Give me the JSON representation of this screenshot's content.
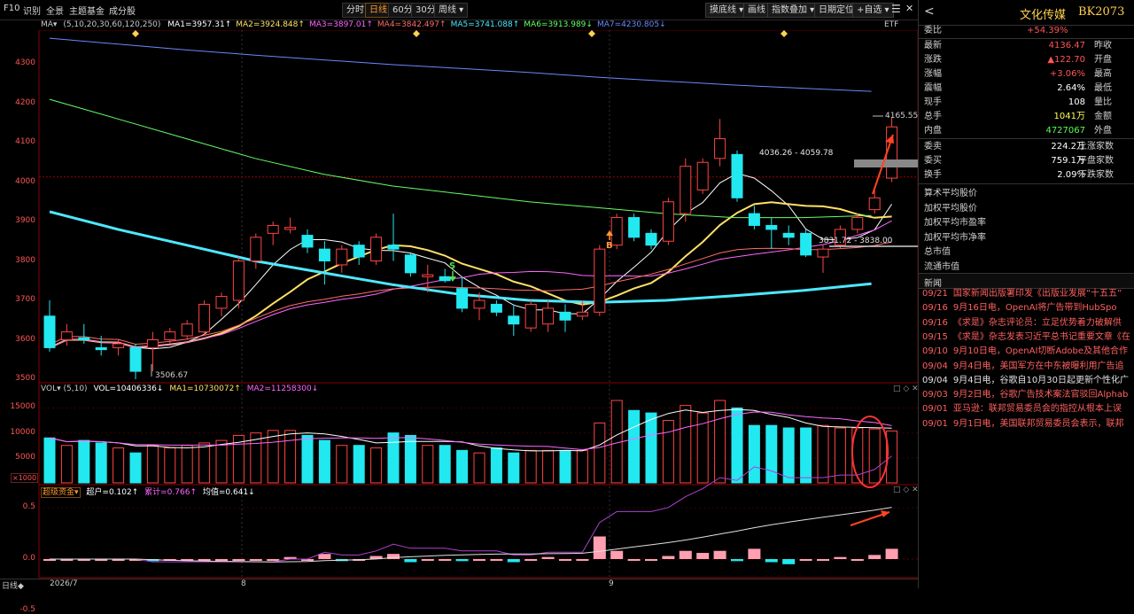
{
  "toolbar": {
    "left_links": [
      "F10",
      "识别",
      "全景",
      "主题基金",
      "成分股"
    ],
    "period_buttons": [
      "分时",
      "日线",
      "60分",
      "30分",
      "周线 ▾"
    ],
    "active_period": "日线",
    "right_buttons": [
      "摸底线 ▾",
      "画线",
      "指数叠加 ▾",
      "日期定位",
      "+自选 ▾"
    ],
    "icons": [
      "☰",
      "✕"
    ]
  },
  "ma_legend": {
    "name": "MA▾",
    "params": "(5,10,20,30,60,120,250)",
    "items": [
      {
        "text": "MA1=3957.31↑",
        "color": "#ffffff"
      },
      {
        "text": "MA2=3924.848↑",
        "color": "#ffe066"
      },
      {
        "text": "MA3=3897.01↑",
        "color": "#ff66ff"
      },
      {
        "text": "MA4=3842.497↑",
        "color": "#ff6b6b"
      },
      {
        "text": "MA5=3741.088↑",
        "color": "#4ee8ff"
      },
      {
        "text": "MA6=3913.989↓",
        "color": "#66ff66"
      },
      {
        "text": "MA7=4230.805↓",
        "color": "#6b88ff"
      }
    ],
    "badge": "ETF"
  },
  "price_axis": [
    "4300",
    "4200",
    "4100",
    "4000",
    "3900",
    "3800",
    "3700",
    "3600",
    "3500"
  ],
  "annotations": {
    "high_label": "4165.55",
    "low_label": "3506.67",
    "range1": "4036.26 - 4059.78",
    "range2": "3831.72 - 3838.00",
    "buy_signal": "B",
    "sell_signal": "S"
  },
  "volume_legend": {
    "name": "VOL▾",
    "params": "(5,10)",
    "vol": "VOL=10406336↓",
    "ma1": "MA1=10730072↑",
    "ma2": "MA2=11258300↓",
    "axis": [
      "15000",
      "10000",
      "5000"
    ],
    "unit": "×1000"
  },
  "capital_legend": {
    "name": "超级资金▾",
    "chao": "超户=0.102↑",
    "leiji": "累计=0.766↑",
    "junzhi": "均值=0.641↓",
    "axis": [
      "0.5",
      "0.0",
      "-0.5"
    ]
  },
  "date_axis": {
    "period": "日线◆",
    "labels": [
      "2026/7",
      "8",
      "9"
    ]
  },
  "chart_data": {
    "type": "candlestick",
    "title": "文化传媒 BK2073",
    "ylim": [
      3480,
      4350
    ],
    "candles": [
      {
        "o": 3660,
        "h": 3700,
        "l": 3570,
        "c": 3580
      },
      {
        "o": 3600,
        "h": 3640,
        "l": 3585,
        "c": 3620
      },
      {
        "o": 3605,
        "h": 3640,
        "l": 3590,
        "c": 3600
      },
      {
        "o": 3580,
        "h": 3610,
        "l": 3560,
        "c": 3575
      },
      {
        "o": 3580,
        "h": 3600,
        "l": 3560,
        "c": 3590
      },
      {
        "o": 3580,
        "h": 3590,
        "l": 3500,
        "c": 3520
      },
      {
        "o": 3580,
        "h": 3620,
        "l": 3520,
        "c": 3600
      },
      {
        "o": 3600,
        "h": 3630,
        "l": 3590,
        "c": 3620
      },
      {
        "o": 3610,
        "h": 3650,
        "l": 3600,
        "c": 3640
      },
      {
        "o": 3620,
        "h": 3700,
        "l": 3610,
        "c": 3690
      },
      {
        "o": 3680,
        "h": 3720,
        "l": 3660,
        "c": 3710
      },
      {
        "o": 3700,
        "h": 3810,
        "l": 3680,
        "c": 3800
      },
      {
        "o": 3800,
        "h": 3870,
        "l": 3780,
        "c": 3860
      },
      {
        "o": 3870,
        "h": 3900,
        "l": 3840,
        "c": 3890
      },
      {
        "o": 3880,
        "h": 3910,
        "l": 3870,
        "c": 3885
      },
      {
        "o": 3865,
        "h": 3880,
        "l": 3820,
        "c": 3835
      },
      {
        "o": 3830,
        "h": 3850,
        "l": 3740,
        "c": 3800
      },
      {
        "o": 3790,
        "h": 3840,
        "l": 3770,
        "c": 3830
      },
      {
        "o": 3840,
        "h": 3850,
        "l": 3790,
        "c": 3810
      },
      {
        "o": 3800,
        "h": 3870,
        "l": 3790,
        "c": 3860
      },
      {
        "o": 3840,
        "h": 3920,
        "l": 3800,
        "c": 3830
      },
      {
        "o": 3815,
        "h": 3820,
        "l": 3760,
        "c": 3770
      },
      {
        "o": 3760,
        "h": 3790,
        "l": 3720,
        "c": 3765
      },
      {
        "o": 3760,
        "h": 3780,
        "l": 3745,
        "c": 3750
      },
      {
        "o": 3730,
        "h": 3760,
        "l": 3670,
        "c": 3680
      },
      {
        "o": 3680,
        "h": 3720,
        "l": 3650,
        "c": 3700
      },
      {
        "o": 3690,
        "h": 3700,
        "l": 3660,
        "c": 3670
      },
      {
        "o": 3660,
        "h": 3690,
        "l": 3610,
        "c": 3640
      },
      {
        "o": 3630,
        "h": 3700,
        "l": 3620,
        "c": 3690
      },
      {
        "o": 3640,
        "h": 3700,
        "l": 3620,
        "c": 3680
      },
      {
        "o": 3670,
        "h": 3690,
        "l": 3620,
        "c": 3650
      },
      {
        "o": 3660,
        "h": 3700,
        "l": 3650,
        "c": 3670
      },
      {
        "o": 3670,
        "h": 3840,
        "l": 3660,
        "c": 3830
      },
      {
        "o": 3840,
        "h": 3920,
        "l": 3830,
        "c": 3910
      },
      {
        "o": 3910,
        "h": 3920,
        "l": 3850,
        "c": 3860
      },
      {
        "o": 3870,
        "h": 3880,
        "l": 3830,
        "c": 3840
      },
      {
        "o": 3850,
        "h": 3960,
        "l": 3840,
        "c": 3950
      },
      {
        "o": 3920,
        "h": 4060,
        "l": 3900,
        "c": 4040
      },
      {
        "o": 3980,
        "h": 4060,
        "l": 3970,
        "c": 4050
      },
      {
        "o": 4060,
        "h": 4160,
        "l": 4040,
        "c": 4110
      },
      {
        "o": 4070,
        "h": 4080,
        "l": 3950,
        "c": 3960
      },
      {
        "o": 3920,
        "h": 3940,
        "l": 3880,
        "c": 3890
      },
      {
        "o": 3890,
        "h": 3910,
        "l": 3830,
        "c": 3880
      },
      {
        "o": 3870,
        "h": 3890,
        "l": 3840,
        "c": 3860
      },
      {
        "o": 3870,
        "h": 3880,
        "l": 3810,
        "c": 3815
      },
      {
        "o": 3810,
        "h": 3840,
        "l": 3770,
        "c": 3830
      },
      {
        "o": 3840,
        "h": 3890,
        "l": 3830,
        "c": 3880
      },
      {
        "o": 3880,
        "h": 3920,
        "l": 3870,
        "c": 3910
      },
      {
        "o": 3930,
        "h": 3980,
        "l": 3920,
        "c": 3960
      },
      {
        "o": 4010,
        "h": 4165,
        "l": 4000,
        "c": 4140
      }
    ],
    "volume": [
      9000,
      7500,
      8500,
      8000,
      7000,
      6000,
      7500,
      7000,
      7500,
      8000,
      8500,
      9500,
      10000,
      10500,
      10500,
      9500,
      8500,
      7500,
      7500,
      7000,
      10000,
      9500,
      7500,
      7500,
      6500,
      6000,
      7000,
      6000,
      6500,
      6500,
      6500,
      6500,
      12000,
      16500,
      14500,
      14000,
      12500,
      15500,
      14000,
      16500,
      15000,
      11500,
      11500,
      11000,
      11000,
      11500,
      11000,
      11000,
      10800,
      10400
    ],
    "capital": [
      0.0,
      0.0,
      0.0,
      0.0,
      0.0,
      0.0,
      -0.02,
      0.0,
      0.0,
      0.0,
      0.0,
      0.0,
      0.0,
      0.0,
      0.02,
      0.0,
      0.05,
      -0.02,
      0.0,
      0.03,
      0.05,
      -0.03,
      0.0,
      0.0,
      -0.02,
      0.0,
      0.0,
      -0.03,
      0.0,
      0.02,
      0.0,
      0.0,
      0.22,
      0.08,
      0.0,
      0.0,
      0.03,
      0.08,
      0.06,
      0.08,
      -0.02,
      0.1,
      -0.03,
      -0.05,
      0.0,
      0.0,
      0.02,
      0.0,
      0.04,
      0.1
    ]
  },
  "right_panel": {
    "back_icon": "<",
    "name": "文化传媒",
    "code": "BK2073",
    "weibi_label": "委比",
    "weibi_value": "+54.39%",
    "rows": [
      {
        "l1": "最新",
        "v1": "4136.47",
        "c1": "#ff5555",
        "l2": "昨收"
      },
      {
        "l1": "涨跌",
        "v1": "▲122.70",
        "c1": "#ff5555",
        "l2": "开盘"
      },
      {
        "l1": "涨幅",
        "v1": "+3.06%",
        "c1": "#ff5555",
        "l2": "最高"
      },
      {
        "l1": "震幅",
        "v1": "2.64%",
        "c1": "#ffffff",
        "l2": "最低"
      },
      {
        "l1": "现手",
        "v1": "108",
        "c1": "#ffffff",
        "l2": "量比"
      },
      {
        "l1": "总手",
        "v1": "1041万",
        "c1": "#ffff55",
        "l2": "金额"
      },
      {
        "l1": "内盘",
        "v1": "4727067",
        "c1": "#55ff55",
        "l2": "外盘"
      }
    ],
    "rows2": [
      {
        "l1": "委卖",
        "v1": "224.2万",
        "c1": "#ffffff",
        "l2": "上涨家数"
      },
      {
        "l1": "委买",
        "v1": "759.1万",
        "c1": "#ffffff",
        "l2": "平盘家数"
      },
      {
        "l1": "换手",
        "v1": "2.09%",
        "c1": "#ffffff",
        "l2": "下跌家数"
      }
    ],
    "labels": [
      "算术平均股价",
      "加权平均股价",
      "加权平均市盈率",
      "加权平均市净率",
      "总市值",
      "流通市值"
    ],
    "news_title": "新闻",
    "news": [
      {
        "date": "09/21",
        "text": "国家新闻出版署印发《出版业发展“十五五”",
        "color": "#ff6060"
      },
      {
        "date": "09/16",
        "text": "9月16日电，OpenAI将广告带到HubSpo",
        "color": "#ff6060"
      },
      {
        "date": "09/16",
        "text": "《求是》杂志评论员：立足优势着力破解供",
        "color": "#ff6060"
      },
      {
        "date": "09/15",
        "text": "《求是》杂志发表习近平总书记重要文章《在",
        "color": "#ff6060"
      },
      {
        "date": "09/10",
        "text": "9月10日电，OpenAI切断Adobe及其他合作",
        "color": "#ff6060"
      },
      {
        "date": "09/04",
        "text": "9月4日电，美国军方在中东被曝利用广告追",
        "color": "#ff6060"
      },
      {
        "date": "09/04",
        "text": "9月4日电，谷歌自10月30日起更新个性化广",
        "color": "#e0e0e0"
      },
      {
        "date": "09/03",
        "text": "9月2日电，谷歌广告技术案法官驳回Alphab",
        "color": "#ff6060"
      },
      {
        "date": "09/01",
        "text": "亚马逊：联邦贸易委员会的指控从根本上误",
        "color": "#ff6060"
      },
      {
        "date": "09/01",
        "text": "9月1日电，美国联邦贸易委员会表示，联邦",
        "color": "#ff6060"
      }
    ]
  }
}
